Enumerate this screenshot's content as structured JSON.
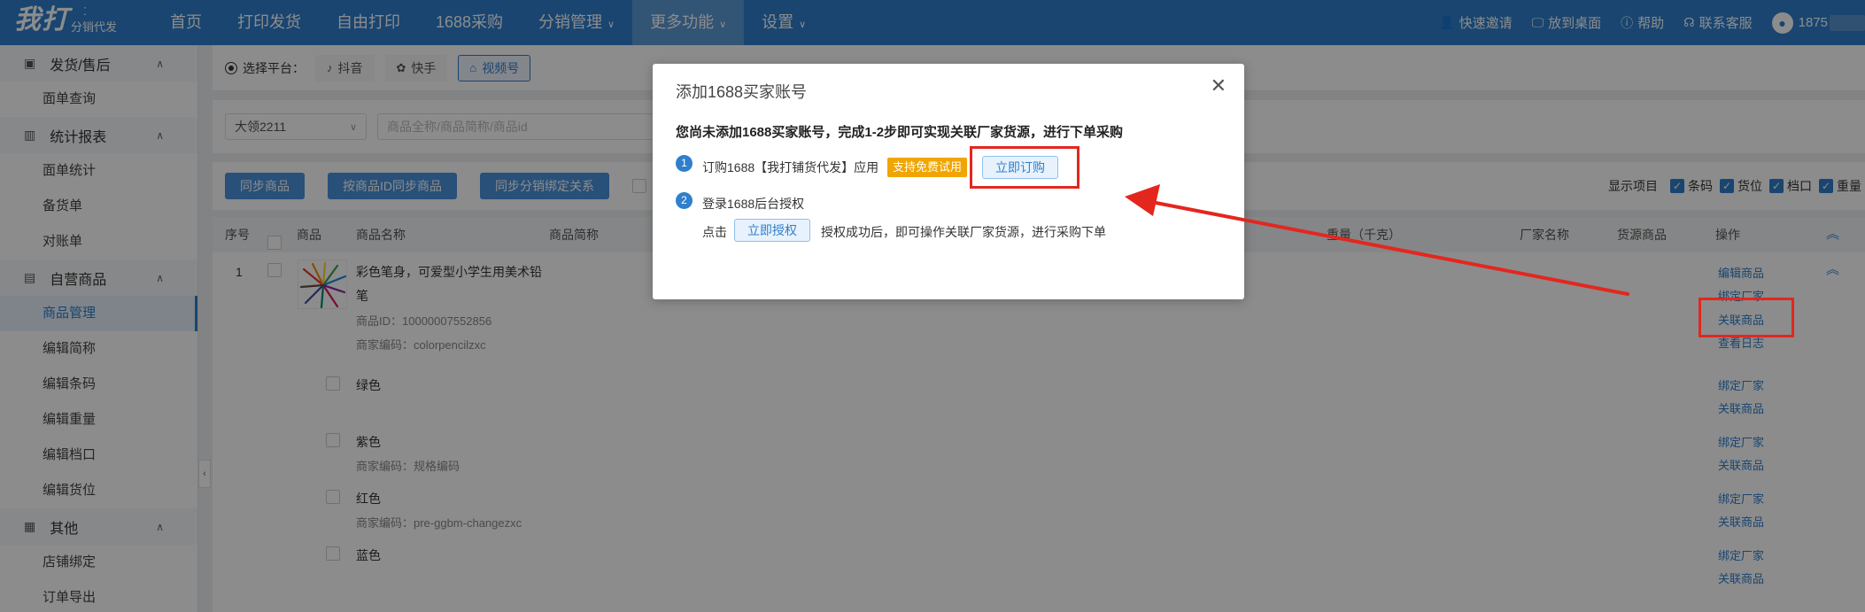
{
  "logo": {
    "main": "我打",
    "sub": "分销代发"
  },
  "nav": [
    {
      "label": "首页",
      "has_chevron": false,
      "active": false
    },
    {
      "label": "打印发货",
      "has_chevron": false,
      "active": false
    },
    {
      "label": "自由打印",
      "has_chevron": false,
      "active": false
    },
    {
      "label": "1688采购",
      "has_chevron": false,
      "active": false
    },
    {
      "label": "分销管理",
      "has_chevron": true,
      "active": false
    },
    {
      "label": "更多功能",
      "has_chevron": true,
      "active": true
    },
    {
      "label": "设置",
      "has_chevron": true,
      "active": false
    }
  ],
  "top_right": {
    "invite": "快速邀请",
    "desktop": "放到桌面",
    "help": "帮助",
    "service": "联系客服",
    "user": "1875"
  },
  "sidebar": {
    "groups": [
      {
        "label": "发货/售后",
        "icon": "truck-icon",
        "items": [
          "面单查询"
        ]
      },
      {
        "label": "统计报表",
        "icon": "chart-icon",
        "items": [
          "面单统计",
          "备货单",
          "对账单"
        ]
      },
      {
        "label": "自营商品",
        "icon": "doc-icon",
        "items": [
          "商品管理",
          "编辑简称",
          "编辑条码",
          "编辑重量",
          "编辑档口",
          "编辑货位"
        ]
      },
      {
        "label": "其他",
        "icon": "grid-icon",
        "items": [
          "店铺绑定",
          "订单导出"
        ]
      }
    ],
    "active_item": "商品管理"
  },
  "platform": {
    "label": "选择平台：",
    "options": [
      "抖音",
      "快手",
      "视频号"
    ],
    "selected": "视频号"
  },
  "filters": {
    "shop_select": "大领2211",
    "search_placeholder": "商品全称/商品简称/商品id"
  },
  "actions": {
    "sync_goods": "同步商品",
    "sync_by_id": "按商品ID同步商品",
    "sync_binding": "同步分销绑定关系",
    "display_label": "显示项目",
    "display_options": [
      "条码",
      "货位",
      "档口",
      "重量"
    ]
  },
  "table": {
    "headers": {
      "index": "序号",
      "goods": "商品",
      "name": "商品名称",
      "short": "商品简称",
      "weight": "重量（千克）",
      "vendor": "厂家名称",
      "source": "货源商品",
      "ops": "操作"
    },
    "product": {
      "index": "1",
      "name_line1": "彩色笔身，可爱型小学生用美术铅",
      "name_line2": "笔",
      "id_text": "商品ID：10000007552856",
      "code_text": "商家编码：colorpencilzxc",
      "ops": [
        "编辑商品",
        "绑定厂家",
        "关联商品",
        "查看日志"
      ]
    },
    "variants": [
      {
        "name": "绿色",
        "code": "",
        "ops": [
          "绑定厂家",
          "关联商品"
        ]
      },
      {
        "name": "紫色",
        "code": "商家编码：规格编码",
        "ops": [
          "绑定厂家",
          "关联商品"
        ]
      },
      {
        "name": "红色",
        "code": "商家编码：pre-ggbm-changezxc",
        "ops": [
          "绑定厂家",
          "关联商品"
        ]
      },
      {
        "name": "蓝色",
        "code": "",
        "ops": [
          "绑定厂家",
          "关联商品"
        ]
      }
    ]
  },
  "modal": {
    "title": "添加1688买家账号",
    "description": "您尚未添加1688买家账号，完成1-2步即可实现关联厂家货源，进行下单采购",
    "step1": {
      "num": "1",
      "text": "订购1688【我打铺货代发】应用",
      "badge": "支持免费试用",
      "button": "立即订购"
    },
    "step2": {
      "num": "2",
      "text": "登录1688后台授权",
      "prefix": "点击",
      "button": "立即授权",
      "suffix": "授权成功后，即可操作关联厂家货源，进行采购下单"
    }
  },
  "colors": {
    "nav_bg": "#2f7fcc",
    "accent": "#2f7fcc",
    "badge": "#f0a500",
    "annotation": "#e3271f"
  }
}
